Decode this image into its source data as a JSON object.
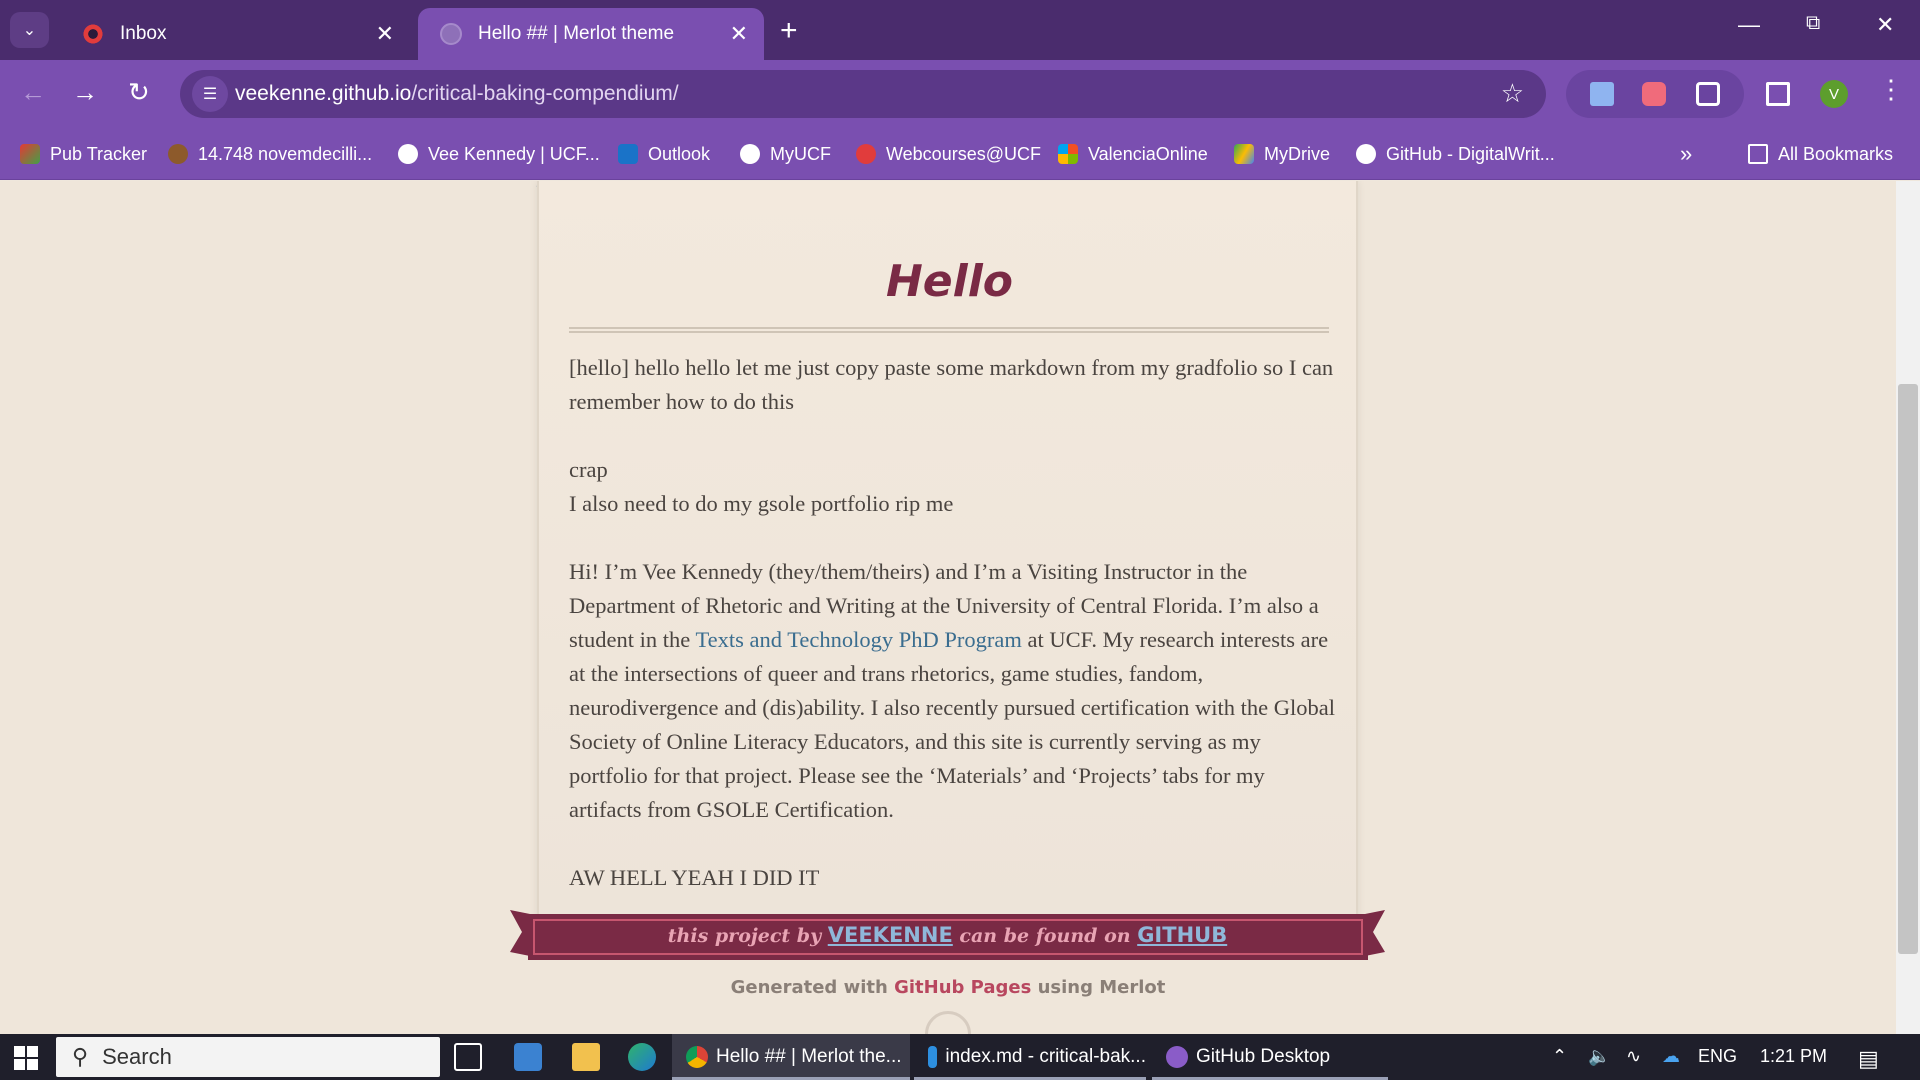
{
  "browser": {
    "tabs": [
      {
        "title": "Inbox",
        "active": false
      },
      {
        "title": "Hello ## | Merlot theme",
        "active": true
      }
    ],
    "url": {
      "host": "veekenne.github.io",
      "path": "/critical-baking-compendium/"
    },
    "profile_initial": "V",
    "bookmarks": [
      {
        "label": "Pub Tracker",
        "icon": "pub-tracker-icon"
      },
      {
        "label": "14.748 novemdecilli...",
        "icon": "cookie-icon"
      },
      {
        "label": "Vee Kennedy | UCF...",
        "icon": "globe-icon"
      },
      {
        "label": "Outlook",
        "icon": "outlook-icon"
      },
      {
        "label": "MyUCF",
        "icon": "globe-icon"
      },
      {
        "label": "Webcourses@UCF",
        "icon": "canvas-icon"
      },
      {
        "label": "ValenciaOnline",
        "icon": "microsoft-icon"
      },
      {
        "label": "MyDrive",
        "icon": "drive-icon"
      },
      {
        "label": "GitHub - DigitalWrit...",
        "icon": "github-icon"
      }
    ],
    "all_bookmarks": "All Bookmarks"
  },
  "page": {
    "title": "Hello",
    "paragraphs": {
      "p1": "[hello] hello hello let me just copy paste some markdown from my gradfolio so I can remember how to do this",
      "p2_line1": "crap",
      "p2_line2": "I also need to do my gsole portfolio rip me",
      "p3_before": "Hi! I’m Vee Kennedy (they/them/theirs) and I’m a Visiting Instructor in the Department of Rhetoric and Writing at the University of Central Florida. I’m also a student in the ",
      "p3_link": "Texts and Technology PhD Program",
      "p3_after": " at UCF. My research interests are at the intersections of queer and trans rhetorics, game studies, fandom, neurodivergence and (dis)ability. I also recently pursued certification with the Global Society of Online Literacy Educators, and this site is currently serving as my portfolio for that project. Please see the ‘Materials’ and ‘Projects’ tabs for my artifacts from GSOLE Certification.",
      "p4": "AW HELL YEAH I DID IT"
    },
    "ribbon": {
      "part1": "this project by ",
      "user": "VEEKENNE",
      "part2": " can be found on ",
      "site": "GITHUB"
    },
    "generated": {
      "before": "Generated with ",
      "link": "GitHub Pages",
      "after": " using Merlot"
    }
  },
  "taskbar": {
    "search_placeholder": "Search",
    "apps": [
      {
        "label": "Hello ## | Merlot the...",
        "icon": "chrome-icon",
        "active": true
      },
      {
        "label": "index.md - critical-bak...",
        "icon": "vscode-icon",
        "active": false
      },
      {
        "label": "GitHub Desktop",
        "icon": "github-desktop-icon",
        "active": false
      }
    ],
    "language": "ENG",
    "time": "1:21 PM"
  },
  "colors": {
    "brand_purple": "#7a4fb0",
    "title_color": "#7a2a45",
    "link_color": "#3a6d8f"
  }
}
